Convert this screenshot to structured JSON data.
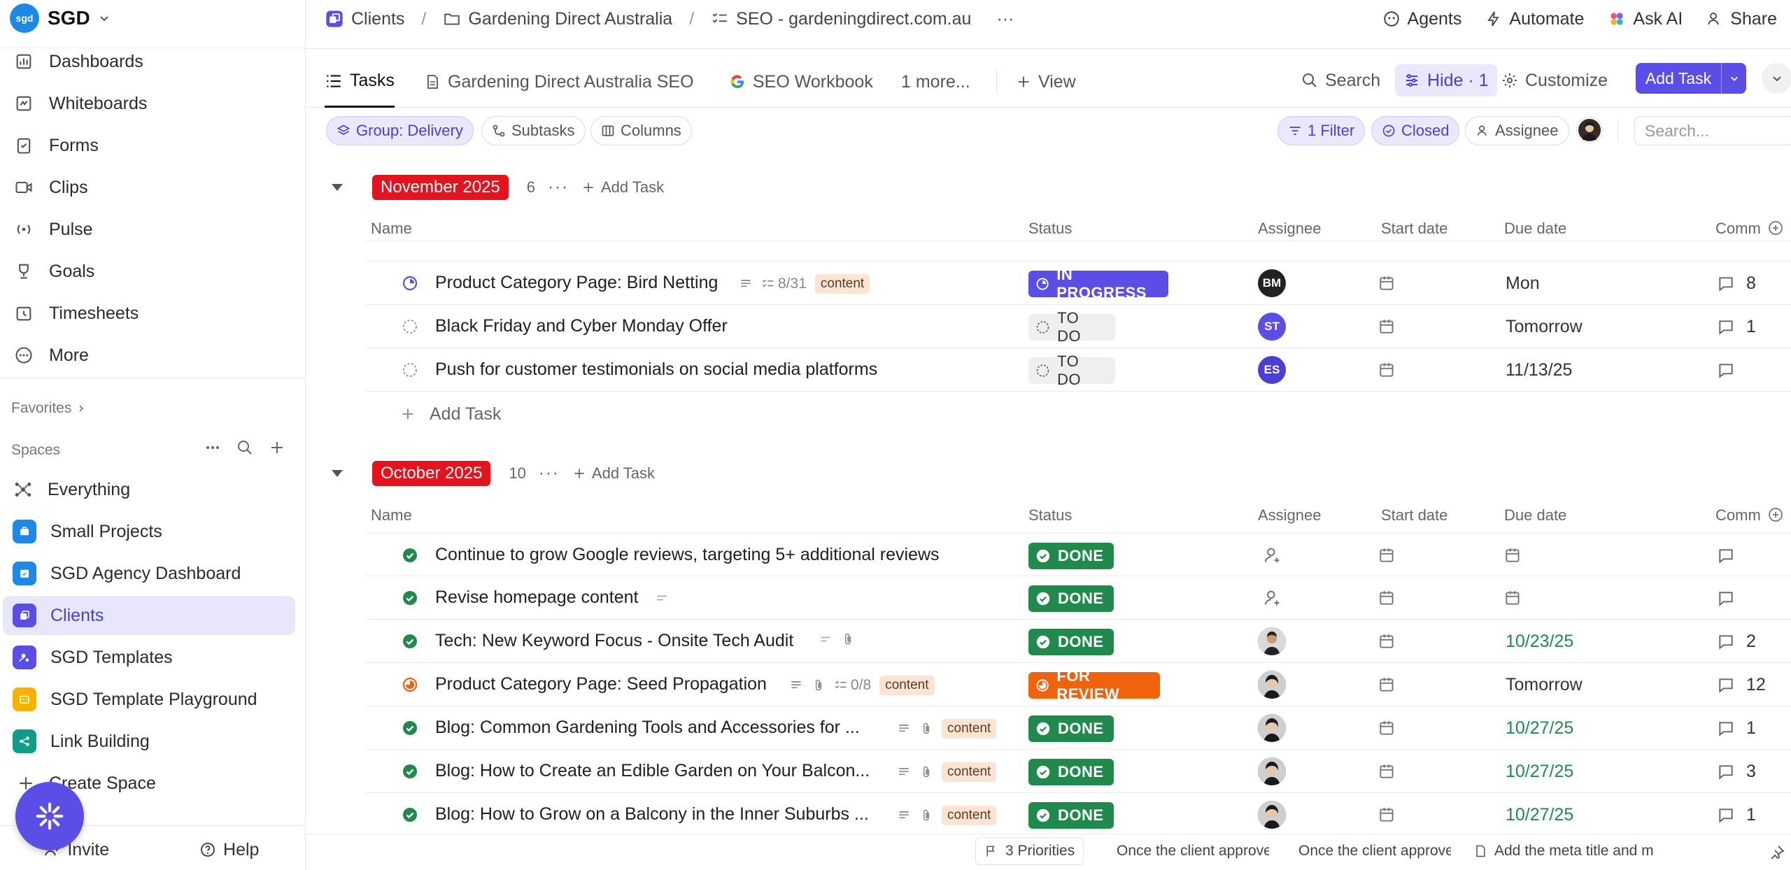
{
  "workspace": {
    "logo_text": "sgd",
    "name": "SGD"
  },
  "sidebar": {
    "nav": [
      {
        "label": "Dashboards",
        "icon": "dashboard-icon"
      },
      {
        "label": "Whiteboards",
        "icon": "whiteboard-icon"
      },
      {
        "label": "Forms",
        "icon": "form-icon"
      },
      {
        "label": "Clips",
        "icon": "video-icon"
      },
      {
        "label": "Pulse",
        "icon": "pulse-icon"
      },
      {
        "label": "Goals",
        "icon": "trophy-icon"
      },
      {
        "label": "Timesheets",
        "icon": "timesheet-icon"
      },
      {
        "label": "More",
        "icon": "more-icon"
      }
    ],
    "favorites_label": "Favorites",
    "spaces_label": "Spaces",
    "spaces": [
      {
        "label": "Everything",
        "color": "#555555"
      },
      {
        "label": "Small Projects",
        "color": "#1e88e5"
      },
      {
        "label": "SGD Agency Dashboard",
        "color": "#1e88e5"
      },
      {
        "label": "Clients",
        "color": "#5b4ee6"
      },
      {
        "label": "SGD Templates",
        "color": "#5b4ee6"
      },
      {
        "label": "SGD Template Playground",
        "color": "#f5b300"
      },
      {
        "label": "Link Building",
        "color": "#0f9d8a"
      }
    ],
    "create_space": "Create Space",
    "invite": "Invite",
    "help": "Help"
  },
  "breadcrumb": {
    "items": [
      "Clients",
      "Gardening Direct Australia",
      "SEO - gardeningdirect.com.au"
    ],
    "more": "···"
  },
  "top_actions": {
    "agents": "Agents",
    "automate": "Automate",
    "ask_ai": "Ask AI",
    "share": "Share"
  },
  "tabs": {
    "items": [
      "Tasks",
      "Gardening Direct Australia SEO",
      "SEO Workbook",
      "1 more...",
      "View"
    ],
    "search": "Search",
    "hide": "Hide · 1",
    "customize": "Customize",
    "add_task": "Add Task"
  },
  "toolbar": {
    "group": "Group: Delivery",
    "subtasks": "Subtasks",
    "columns": "Columns",
    "filter": "1 Filter",
    "closed": "Closed",
    "assignee": "Assignee",
    "search_placeholder": "Search..."
  },
  "columns": {
    "name": "Name",
    "status": "Status",
    "assignee": "Assignee",
    "start": "Start date",
    "due": "Due date",
    "comments": "Comm"
  },
  "groups": [
    {
      "title": "November 2025",
      "count": "6",
      "add": "Add Task",
      "tasks": [
        {
          "name": "Product Category Page: Bird Netting",
          "status": "IN PROGRESS",
          "subtasks": "8/31",
          "tag": "content",
          "assignee": "BM",
          "due": "Mon",
          "comments": "8"
        },
        {
          "name": "Black Friday and Cyber Monday Offer",
          "status": "TO DO",
          "assignee": "ST",
          "due": "Tomorrow",
          "comments": "1"
        },
        {
          "name": "Push for customer testimonials on social media platforms",
          "status": "TO DO",
          "assignee": "ES",
          "due": "11/13/25",
          "comments": ""
        }
      ],
      "add_row": "Add Task"
    },
    {
      "title": "October 2025",
      "count": "10",
      "add": "Add Task",
      "tasks": [
        {
          "name": "Continue to grow Google reviews, targeting 5+ additional reviews",
          "status": "DONE",
          "due": "",
          "comments": ""
        },
        {
          "name": "Revise homepage content",
          "status": "DONE",
          "due": "",
          "comments": ""
        },
        {
          "name": "Tech: New Keyword Focus - Onsite Tech Audit",
          "status": "DONE",
          "due": "10/23/25",
          "comments": "2"
        },
        {
          "name": "Product Category Page: Seed Propagation",
          "status": "FOR REVIEW",
          "subtasks": "0/8",
          "tag": "content",
          "due": "Tomorrow",
          "comments": "12"
        },
        {
          "name": "Blog: Common Gardening Tools and Accessories for ...",
          "status": "DONE",
          "tag": "content",
          "due": "10/27/25",
          "comments": "1"
        },
        {
          "name": "Blog: How to Create an Edible Garden on Your Balcon...",
          "status": "DONE",
          "tag": "content",
          "due": "10/27/25",
          "comments": "3"
        },
        {
          "name": "Blog: How to Grow on a Balcony in the Inner Suburbs ...",
          "status": "DONE",
          "tag": "content",
          "due": "10/27/25",
          "comments": "1"
        }
      ]
    }
  ],
  "statusbar": {
    "priorities": "3 Priorities",
    "doc1": "Once the client approve",
    "doc2": "Once the client approve",
    "doc3": "Add the meta title and m"
  },
  "colors": {
    "accent": "#5b4ee6",
    "done": "#1f8a4c",
    "review": "#f0620b",
    "group": "#e5131d"
  }
}
